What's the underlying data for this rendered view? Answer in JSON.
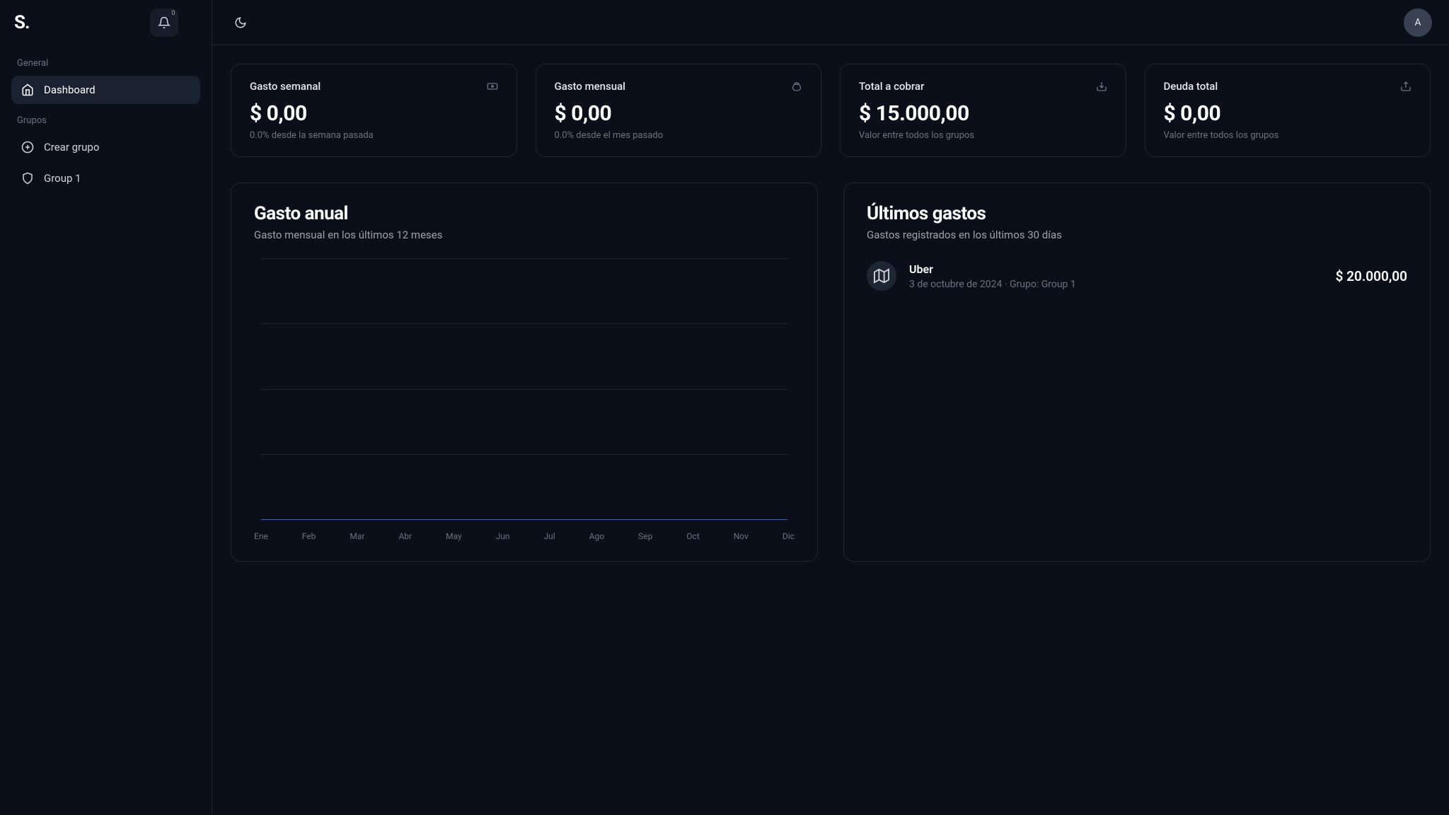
{
  "header": {
    "logo": "S.",
    "notification_count": "0",
    "avatar_initial": "A"
  },
  "sidebar": {
    "sections": [
      {
        "title": "General",
        "items": [
          {
            "label": "Dashboard",
            "active": true
          }
        ]
      },
      {
        "title": "Grupos",
        "items": [
          {
            "label": "Crear grupo",
            "active": false
          },
          {
            "label": "Group 1",
            "active": false
          }
        ]
      }
    ]
  },
  "stats": [
    {
      "title": "Gasto semanal",
      "value": "$ 0,00",
      "subtitle": "0.0% desde la semana pasada"
    },
    {
      "title": "Gasto mensual",
      "value": "$ 0,00",
      "subtitle": "0.0% desde el mes pasado"
    },
    {
      "title": "Total a cobrar",
      "value": "$ 15.000,00",
      "subtitle": "Valor entre todos los grupos"
    },
    {
      "title": "Deuda total",
      "value": "$ 0,00",
      "subtitle": "Valor entre todos los grupos"
    }
  ],
  "annual_chart": {
    "title": "Gasto anual",
    "subtitle": "Gasto mensual en los últimos 12 meses"
  },
  "chart_data": {
    "type": "bar",
    "categories": [
      "Ene",
      "Feb",
      "Mar",
      "Abr",
      "May",
      "Jun",
      "Jul",
      "Ago",
      "Sep",
      "Oct",
      "Nov",
      "Dic"
    ],
    "values": [
      0,
      0,
      0,
      0,
      0,
      0,
      0,
      0,
      0,
      0,
      0,
      0
    ],
    "title": "Gasto anual",
    "xlabel": "",
    "ylabel": "",
    "ylim": [
      0,
      100
    ]
  },
  "recent_expenses": {
    "title": "Últimos gastos",
    "subtitle": "Gastos registrados en los últimos 30 días",
    "items": [
      {
        "name": "Uber",
        "date": "3 de octubre de 2024",
        "group": "Grupo: Group 1",
        "amount": "$ 20.000,00"
      }
    ]
  }
}
